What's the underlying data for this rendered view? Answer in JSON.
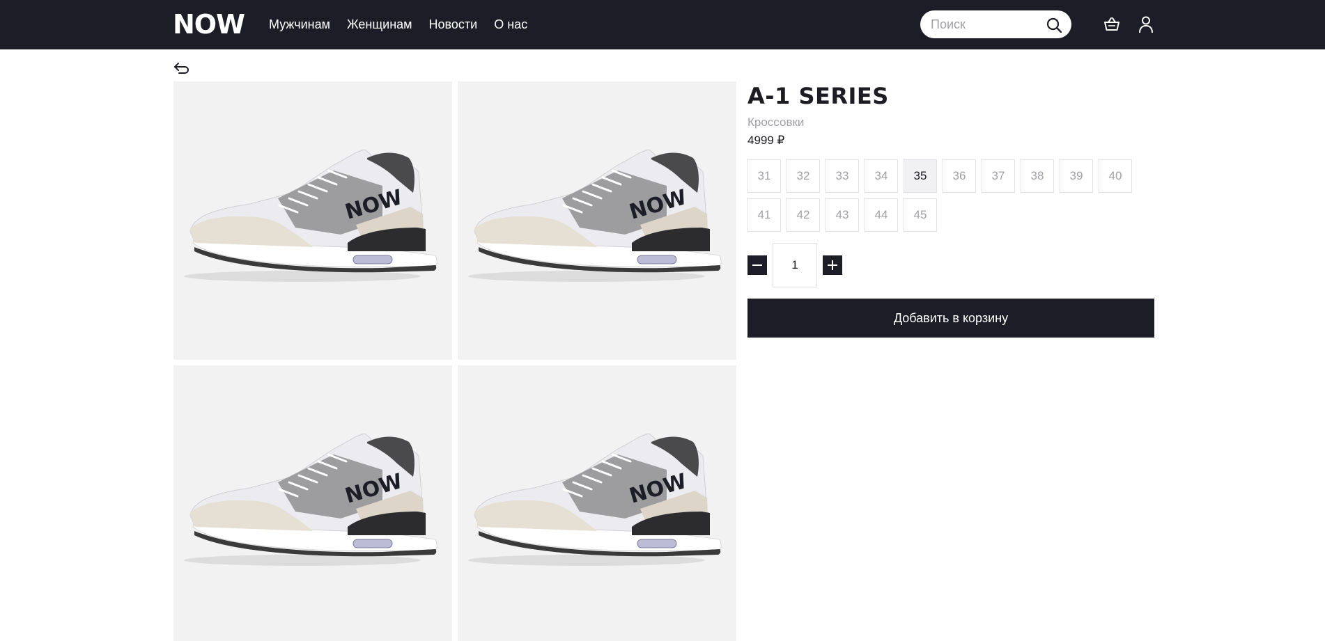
{
  "header": {
    "logo": "NOW",
    "nav": [
      "Мужчинам",
      "Женщинам",
      "Новости",
      "О нас"
    ],
    "search_placeholder": "Поиск",
    "icons": [
      "search-icon",
      "cart-icon",
      "user-icon"
    ]
  },
  "back_icon": "back-arrow-icon",
  "gallery": {
    "images": [
      {
        "alt": "A-1 SERIES",
        "logo_text": "NOW"
      },
      {
        "alt": "A-1 SERIES",
        "logo_text": "NOW"
      },
      {
        "alt": "A-1 SERIES",
        "logo_text": "NOW"
      },
      {
        "alt": "A-1 SERIES",
        "logo_text": "NOW"
      }
    ]
  },
  "product": {
    "title": "A-1 SERIES",
    "category": "Кроссовки",
    "price": "4999 ₽",
    "sizes": [
      "31",
      "32",
      "33",
      "34",
      "35",
      "36",
      "37",
      "38",
      "39",
      "40",
      "41",
      "42",
      "43",
      "44",
      "45"
    ],
    "selected_size": "35",
    "quantity": "1",
    "add_to_cart_label": "Добавить в корзину"
  },
  "colors": {
    "header_bg": "#1d1d27",
    "tile_bg": "#f2f2f2",
    "muted_text": "#a0a0a6"
  }
}
